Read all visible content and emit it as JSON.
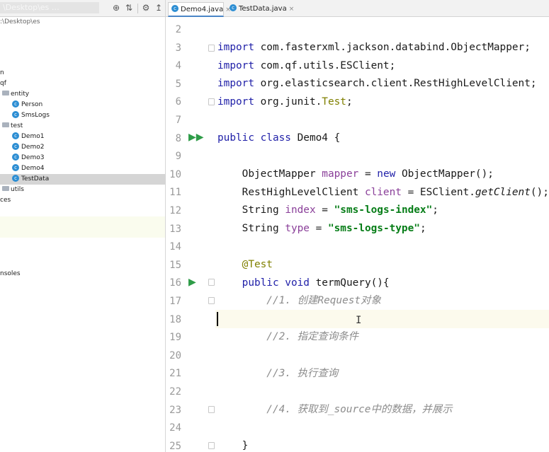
{
  "project_panel": {
    "title": "\\Desktop\\es …",
    "toolbar_icons": [
      "target-icon",
      "collapse-icon",
      "gear-icon",
      "hide-icon"
    ],
    "tree": [
      {
        "label": ":\\Desktop\\es",
        "kind": "path"
      },
      {
        "label": "n",
        "kind": "text"
      },
      {
        "label": "qf",
        "kind": "text"
      },
      {
        "label": "entity",
        "kind": "folder"
      },
      {
        "label": "Person",
        "kind": "class"
      },
      {
        "label": "SmsLogs",
        "kind": "class"
      },
      {
        "label": "test",
        "kind": "folder"
      },
      {
        "label": "Demo1",
        "kind": "class"
      },
      {
        "label": "Demo2",
        "kind": "class"
      },
      {
        "label": "Demo3",
        "kind": "class"
      },
      {
        "label": "Demo4",
        "kind": "class"
      },
      {
        "label": "TestData",
        "kind": "class",
        "selected": true
      },
      {
        "label": "utils",
        "kind": "folder"
      },
      {
        "label": "ces",
        "kind": "text"
      },
      {
        "label": "nsoles",
        "kind": "text"
      }
    ]
  },
  "tabs": [
    {
      "label": "Demo4.java",
      "active": true
    },
    {
      "label": "TestData.java",
      "active": false
    }
  ],
  "tab_close_glyph": "×",
  "class_glyph": "c",
  "editor": {
    "line_numbers": [
      "2",
      "3",
      "4",
      "5",
      "6",
      "7",
      "8",
      "9",
      "10",
      "11",
      "12",
      "13",
      "14",
      "15",
      "16",
      "17",
      "18",
      "19",
      "20",
      "21",
      "22",
      "23",
      "24",
      "25"
    ],
    "current_line": "18",
    "code": {
      "l3_kw": "import",
      "l3": " com.fasterxml.jackson.databind.ObjectMapper;",
      "l4_kw": "import",
      "l4": " com.qf.utils.ESClient;",
      "l5_kw": "import",
      "l5": " org.elasticsearch.client.RestHighLevelClient;",
      "l6_kw": "import",
      "l6a": " org.junit.",
      "l6b": "Test",
      "l6c": ";",
      "l8_kw": "public class",
      "l8": " Demo4 {",
      "l10a": "    ObjectMapper ",
      "l10b": "mapper",
      "l10c": " = ",
      "l10d": "new",
      "l10e": " ObjectMapper();",
      "l11a": "    RestHighLevelClient ",
      "l11b": "client",
      "l11c": " = ESClient.",
      "l11d": "getClient",
      "l11e": "();",
      "l12a": "    String ",
      "l12b": "index",
      "l12c": " = ",
      "l12d": "\"sms-logs-index\"",
      "l12e": ";",
      "l13a": "    String ",
      "l13b": "type",
      "l13c": " = ",
      "l13d": "\"sms-logs-type\"",
      "l13e": ";",
      "l15": "    @Test",
      "l16a": "    ",
      "l16b": "public void",
      "l16c": " termQuery(){",
      "l17": "        //1. 创建Request对象",
      "l19": "        //2. 指定查询条件",
      "l21": "        //3. 执行查询",
      "l23": "        //4. 获取到_source中的数据，并展示",
      "l25": "    }"
    }
  },
  "colors": {
    "keyword": "#1f1fa8",
    "string": "#067d17",
    "field": "#8a3f99",
    "annotation": "#808000",
    "comment": "#8c8c8c",
    "run_icon": "#2e9c48",
    "current_line": "#fcfaed",
    "selection": "#d5d5d5"
  }
}
